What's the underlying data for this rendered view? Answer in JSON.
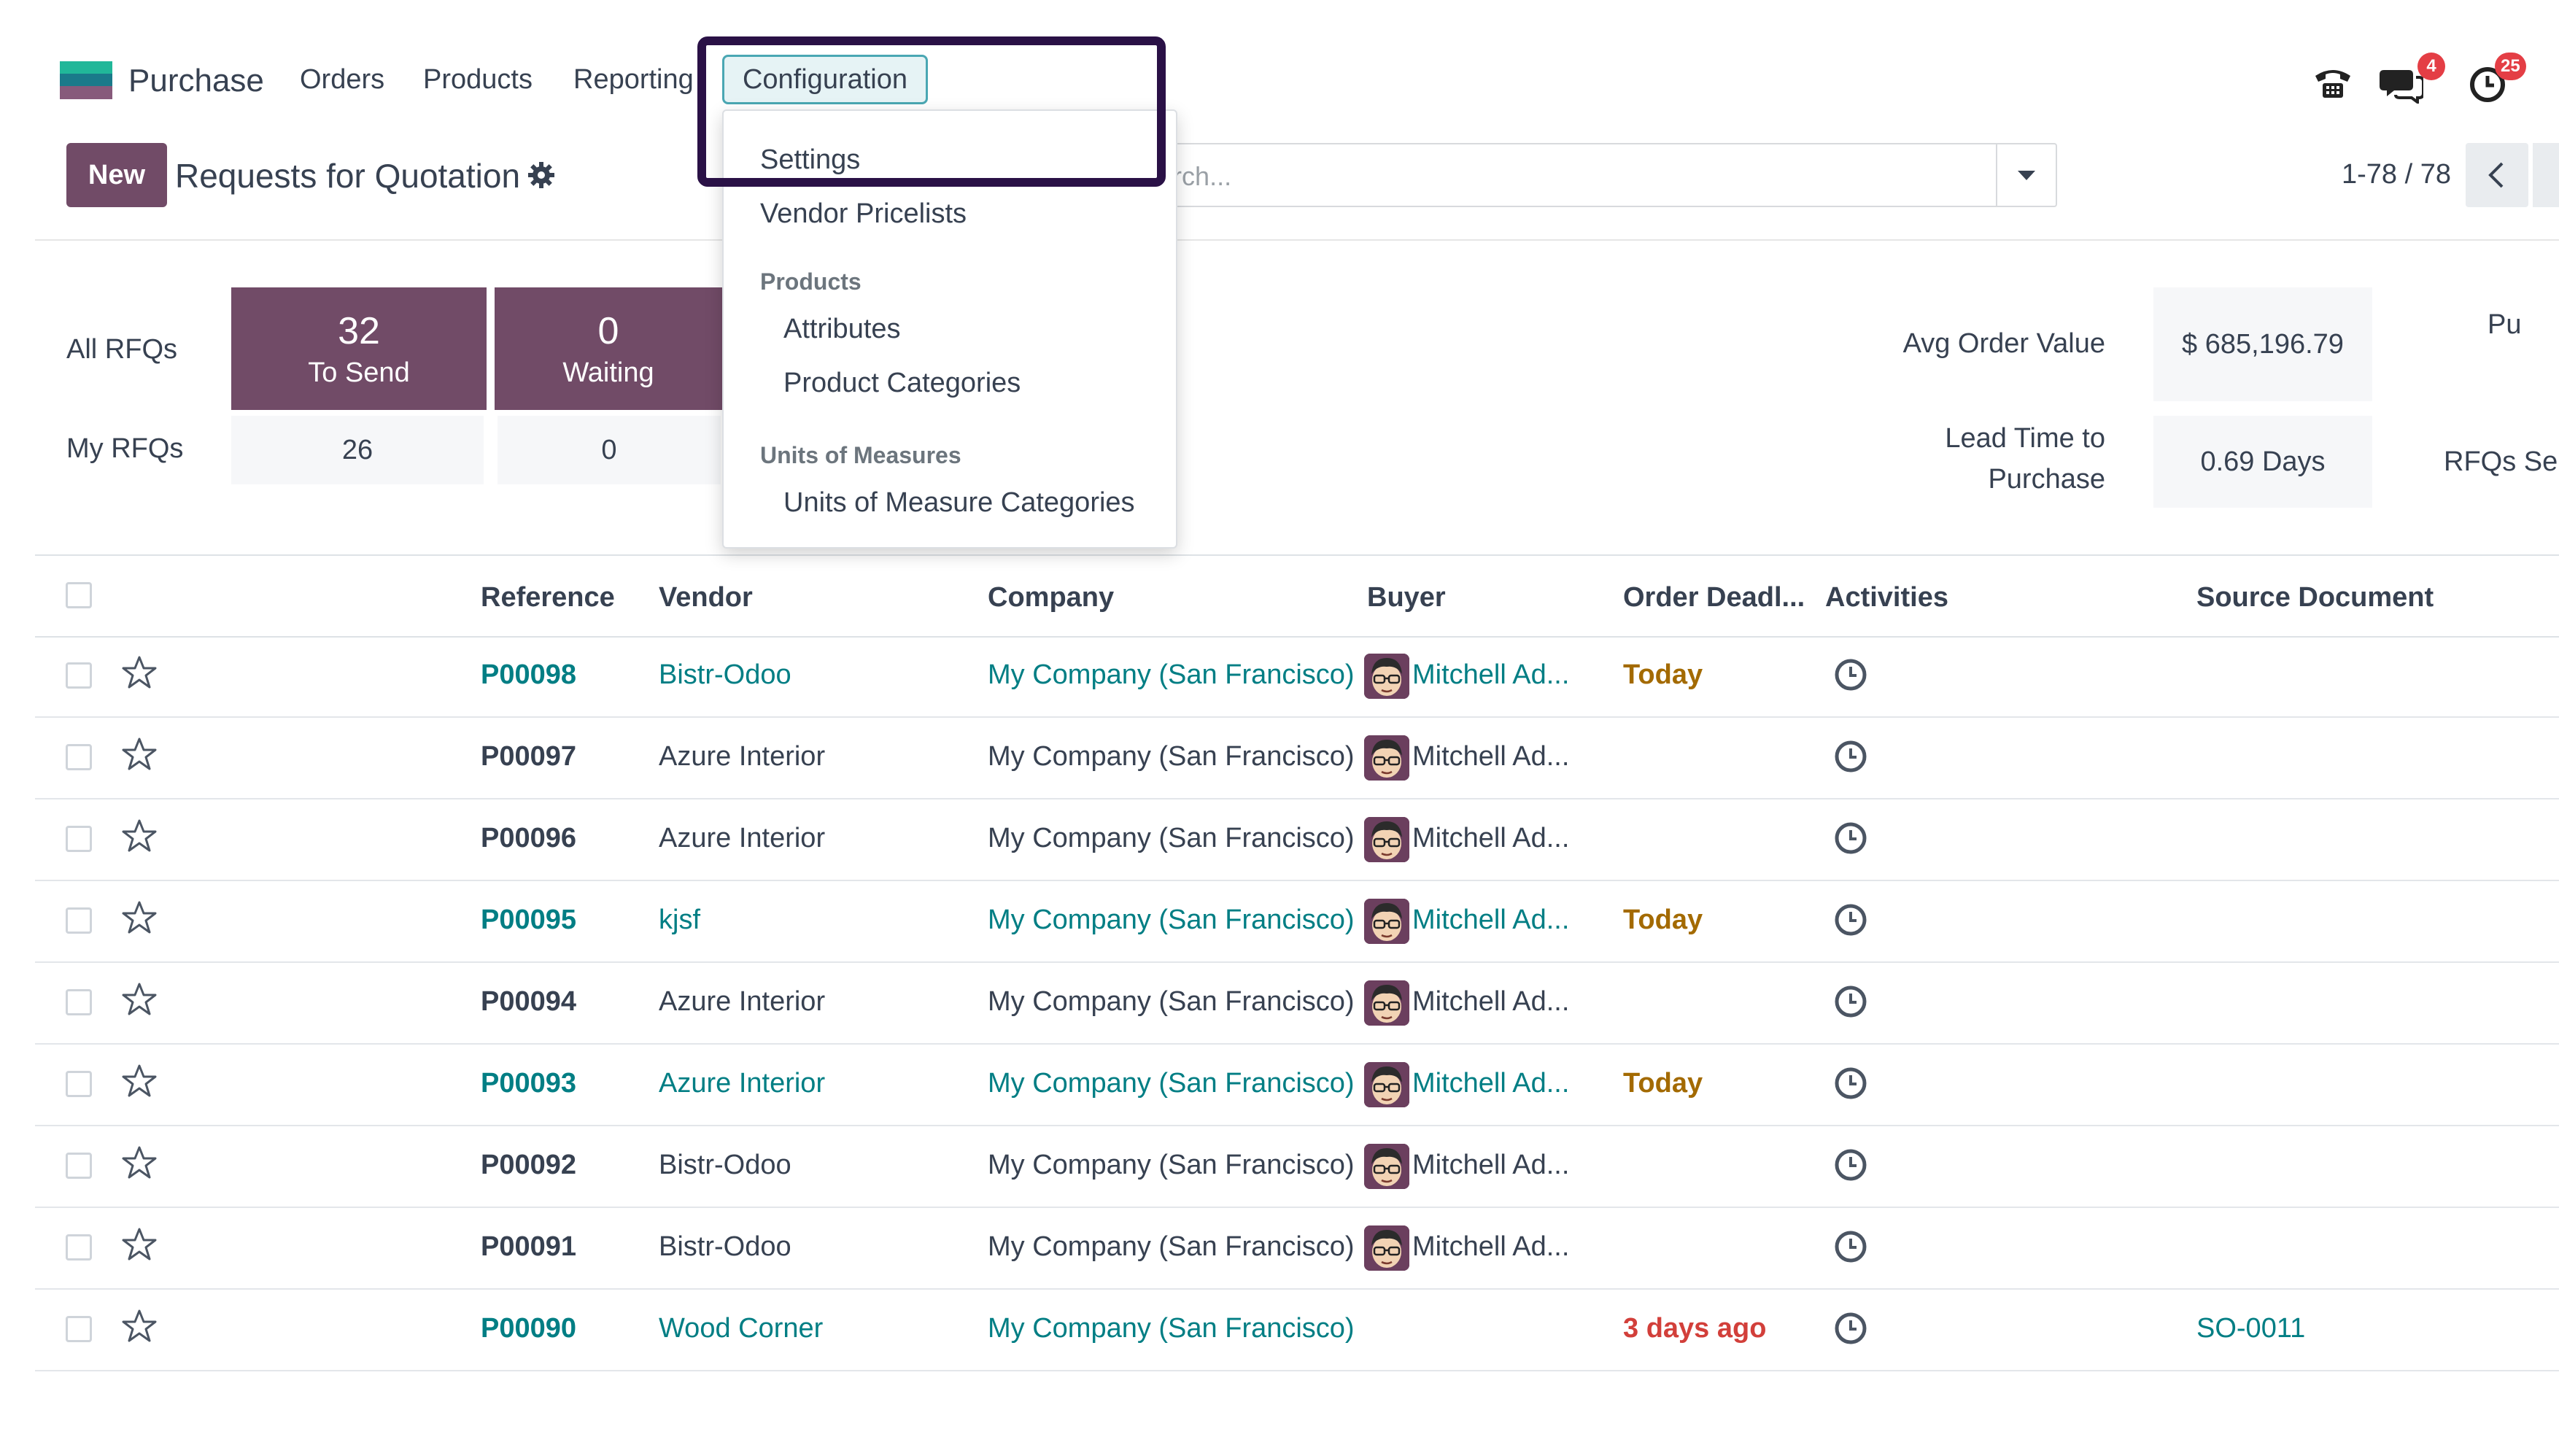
{
  "app": {
    "name": "Purchase"
  },
  "nav": {
    "items": [
      "Orders",
      "Products",
      "Reporting",
      "Configuration"
    ]
  },
  "systray": {
    "messages_count": "4",
    "activities_count": "25"
  },
  "control_panel": {
    "new_label": "New",
    "title": "Requests for Quotation",
    "search_placeholder": "Search...",
    "pager": "1-78 / 78"
  },
  "stats": {
    "all_rfqs_label": "All RFQs",
    "my_rfqs_label": "My RFQs",
    "tiles": [
      {
        "count": "32",
        "label": "To Send",
        "mine": "26"
      },
      {
        "count": "0",
        "label": "Waiting",
        "mine": "0"
      }
    ],
    "kpis": [
      {
        "label": "Avg Order Value",
        "value": "$ 685,196.79",
        "extra": "Pu"
      },
      {
        "label_line1": "Lead Time to",
        "label_line2": "Purchase",
        "value": "0.69 Days",
        "extra": "RFQs Se"
      }
    ]
  },
  "table": {
    "columns": [
      "Reference",
      "Vendor",
      "Company",
      "Buyer",
      "Order Deadl...",
      "Activities",
      "Source Document"
    ],
    "rows": [
      {
        "ref": "P00098",
        "vendor": "Bistr-Odoo",
        "company": "My Company (San Francisco)",
        "buyer": "Mitchell Ad...",
        "deadline": "Today",
        "source": "",
        "highlight": true
      },
      {
        "ref": "P00097",
        "vendor": "Azure Interior",
        "company": "My Company (San Francisco)",
        "buyer": "Mitchell Ad...",
        "deadline": "",
        "source": "",
        "highlight": false
      },
      {
        "ref": "P00096",
        "vendor": "Azure Interior",
        "company": "My Company (San Francisco)",
        "buyer": "Mitchell Ad...",
        "deadline": "",
        "source": "",
        "highlight": false
      },
      {
        "ref": "P00095",
        "vendor": "kjsf",
        "company": "My Company (San Francisco)",
        "buyer": "Mitchell Ad...",
        "deadline": "Today",
        "source": "",
        "highlight": true
      },
      {
        "ref": "P00094",
        "vendor": "Azure Interior",
        "company": "My Company (San Francisco)",
        "buyer": "Mitchell Ad...",
        "deadline": "",
        "source": "",
        "highlight": false
      },
      {
        "ref": "P00093",
        "vendor": "Azure Interior",
        "company": "My Company (San Francisco)",
        "buyer": "Mitchell Ad...",
        "deadline": "Today",
        "source": "",
        "highlight": true
      },
      {
        "ref": "P00092",
        "vendor": "Bistr-Odoo",
        "company": "My Company (San Francisco)",
        "buyer": "Mitchell Ad...",
        "deadline": "",
        "source": "",
        "highlight": false
      },
      {
        "ref": "P00091",
        "vendor": "Bistr-Odoo",
        "company": "My Company (San Francisco)",
        "buyer": "Mitchell Ad...",
        "deadline": "",
        "source": "",
        "highlight": false
      },
      {
        "ref": "P00090",
        "vendor": "Wood Corner",
        "company": "My Company (San Francisco)",
        "buyer": "",
        "deadline": "3 days ago",
        "source": "SO-0011",
        "highlight": true
      }
    ]
  },
  "config_menu": {
    "settings": "Settings",
    "vendor_pricelists": "Vendor Pricelists",
    "products_header": "Products",
    "attributes": "Attributes",
    "product_categories": "Product Categories",
    "uom_header": "Units of Measures",
    "uom_categories": "Units of Measure Categories"
  },
  "colors": {
    "brand": "#714b67",
    "link": "#017e84",
    "today": "#a36a00",
    "overdue": "#d23f3a",
    "annotation": "#2a1146"
  }
}
